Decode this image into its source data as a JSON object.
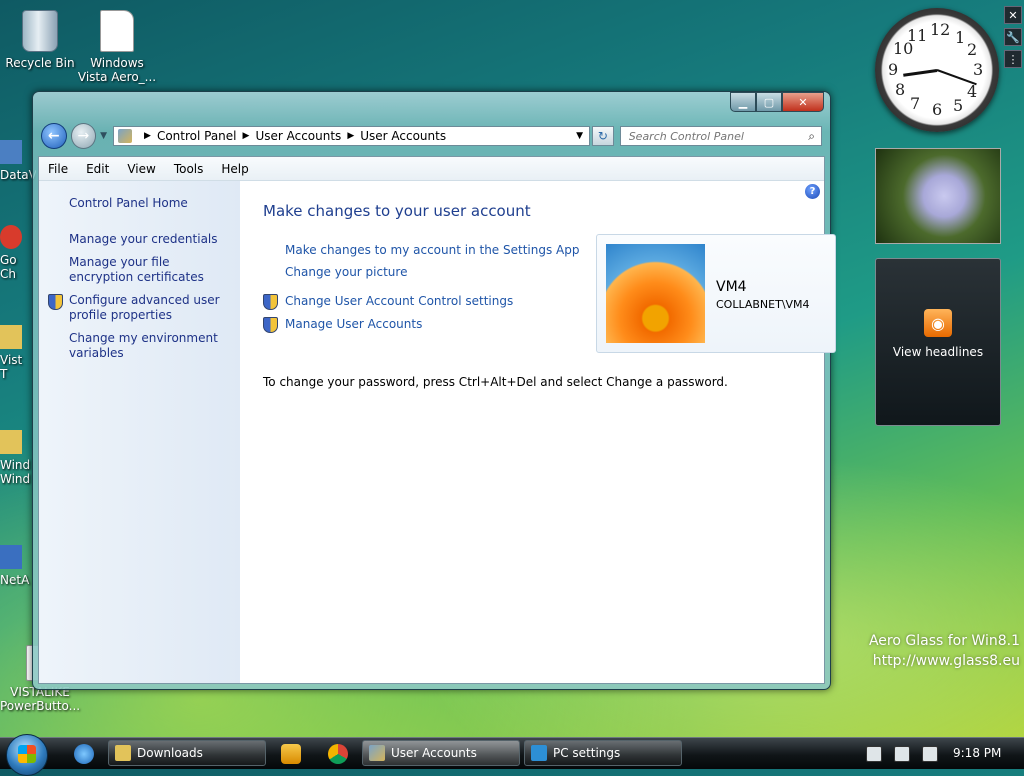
{
  "desktop": {
    "icons": [
      {
        "label": "Recycle Bin"
      },
      {
        "label": "Windows Vista Aero_..."
      }
    ],
    "partial_icons": [
      "DataV",
      "Go Ch",
      "Vist T",
      "Wind Wind",
      "NetA"
    ],
    "bottom_icon": "VISTALIKE PowerButto..."
  },
  "window": {
    "breadcrumb": [
      "Control Panel",
      "User Accounts",
      "User Accounts"
    ],
    "search_placeholder": "Search Control Panel",
    "menu": [
      "File",
      "Edit",
      "View",
      "Tools",
      "Help"
    ],
    "sidebar": {
      "home": "Control Panel Home",
      "links": [
        {
          "label": "Manage your credentials",
          "shield": false
        },
        {
          "label": "Manage your file encryption certificates",
          "shield": false
        },
        {
          "label": "Configure advanced user profile properties",
          "shield": true
        },
        {
          "label": "Change my environment variables",
          "shield": false
        }
      ]
    },
    "main": {
      "heading": "Make changes to your user account",
      "links": [
        {
          "label": "Make changes to my account in the Settings App",
          "shield": false
        },
        {
          "label": "Change your picture",
          "shield": false
        },
        {
          "label": "Change User Account Control settings",
          "shield": true
        },
        {
          "label": "Manage User Accounts",
          "shield": true
        }
      ],
      "user": {
        "name": "VM4",
        "domain": "COLLABNET\\VM4"
      },
      "password_note": "To change your password, press Ctrl+Alt+Del and select Change a password."
    }
  },
  "gadgets": {
    "clock_numbers": [
      "12",
      "1",
      "2",
      "3",
      "4",
      "5",
      "6",
      "7",
      "8",
      "9",
      "10",
      "11"
    ],
    "feed_label": "View headlines"
  },
  "watermark": {
    "line1": "Aero Glass for Win8.1",
    "line2": "http://www.glass8.eu"
  },
  "taskbar": {
    "buttons": [
      {
        "label": "Downloads"
      },
      {
        "label": "User Accounts"
      },
      {
        "label": "PC settings"
      }
    ],
    "time": "9:18 PM"
  },
  "colors": {
    "link": "#1f55a8",
    "heading": "#1f3f8f",
    "sidebar_link": "#1e3287"
  }
}
